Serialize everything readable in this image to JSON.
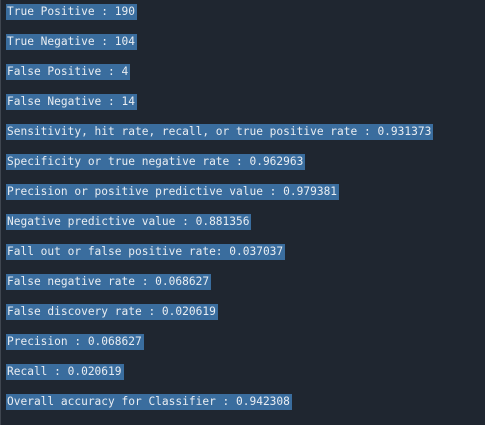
{
  "output_lines": [
    "True Positive : 190",
    "True Negative : 104",
    "False Positive : 4",
    "False Negative : 14",
    "Sensitivity, hit rate, recall, or true positive rate : 0.931373",
    "Specificity or true negative rate : 0.962963",
    "Precision or positive predictive value : 0.979381",
    "Negative predictive value : 0.881356",
    "Fall out or false positive rate: 0.037037",
    "False negative rate : 0.068627",
    "False discovery rate : 0.020619",
    "Precision : 0.068627",
    "Recall : 0.020619",
    "Overall accuracy for Classifier : 0.942308"
  ],
  "colors": {
    "background": "#1f2630",
    "selection": "#3a6d9e",
    "text": "#e9edf2"
  }
}
